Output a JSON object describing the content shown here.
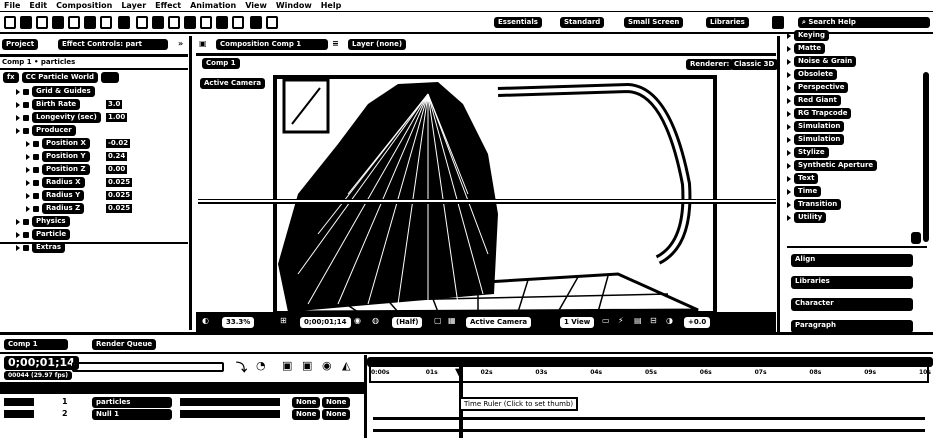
{
  "menu": [
    "File",
    "Edit",
    "Composition",
    "Layer",
    "Effect",
    "Animation",
    "View",
    "Window",
    "Help"
  ],
  "workspaces": {
    "essentials": "Essentials",
    "standard": "Standard",
    "small_screen": "Small Screen",
    "libraries": "Libraries"
  },
  "search_help": {
    "placeholder": "Search Help"
  },
  "left_panel": {
    "tabs": {
      "project": "Project",
      "effect_controls": "Effect Controls: part"
    },
    "breadcrumb": "Comp 1 • particles",
    "effect_name": "CC Particle World",
    "rows": [
      {
        "label": "Grid & Guides",
        "indent": 1
      },
      {
        "label": "Birth Rate",
        "indent": 1,
        "value": "3.0"
      },
      {
        "label": "Longevity (sec)",
        "indent": 1,
        "value": "1.00"
      },
      {
        "label": "Producer",
        "indent": 1
      },
      {
        "label": "Position X",
        "indent": 2,
        "value": "-0.02"
      },
      {
        "label": "Position Y",
        "indent": 2,
        "value": "0.24"
      },
      {
        "label": "Position Z",
        "indent": 2,
        "value": "0.00"
      },
      {
        "label": "Radius X",
        "indent": 2,
        "value": "0.025"
      },
      {
        "label": "Radius Y",
        "indent": 2,
        "value": "0.025"
      },
      {
        "label": "Radius Z",
        "indent": 2,
        "value": "0.025"
      },
      {
        "label": "Physics",
        "indent": 1
      },
      {
        "label": "Particle",
        "indent": 1
      },
      {
        "label": "Extras",
        "indent": 1
      }
    ]
  },
  "viewer": {
    "tab": "Composition Comp 1",
    "layer_tab": "Layer (none)",
    "comp_chip": "Comp 1",
    "renderer_label": "Renderer:",
    "renderer_value": "Classic 3D",
    "active_camera": "Active Camera",
    "footer": {
      "zoom": "33.3%",
      "timecode": "0;00;01;14",
      "resolution": "(Half)",
      "camera": "Active Camera",
      "views": "1 View",
      "offset": "+0.0"
    }
  },
  "right_panel": {
    "effects": [
      "Keying",
      "Matte",
      "Noise & Grain",
      "Obsolete",
      "Perspective",
      "Red Giant",
      "RG Trapcode",
      "Simulation",
      "Simulation",
      "Stylize",
      "Synthetic Aperture",
      "Text",
      "Time",
      "Transition",
      "Utility"
    ],
    "sections": [
      "Align",
      "Libraries",
      "Character",
      "Paragraph"
    ]
  },
  "timeline": {
    "tabs": {
      "comp": "Comp 1",
      "render_queue": "Render Queue"
    },
    "timecode": "0;00;01;14",
    "fps": "00044 (29.97 fps)",
    "ruler_ticks": [
      "0:00s",
      "01s",
      "02s",
      "03s",
      "04s",
      "05s",
      "06s",
      "07s",
      "08s",
      "09s",
      "10s"
    ],
    "tooltip": "Time Ruler (Click to set thumb)",
    "layers": [
      {
        "num": "1",
        "name": "particles",
        "mode": "None"
      },
      {
        "num": "2",
        "name": "Null 1",
        "mode": "None"
      }
    ]
  }
}
